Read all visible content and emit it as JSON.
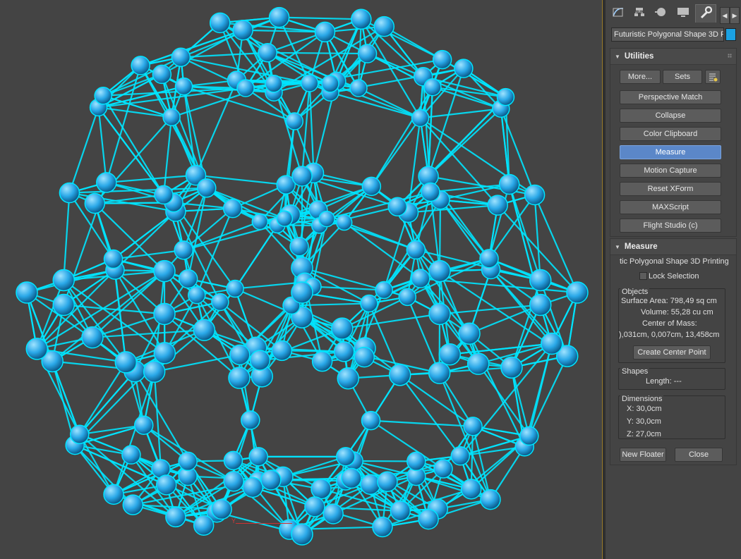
{
  "command_panel": {
    "tabs": [
      {
        "icon": "create-icon"
      },
      {
        "icon": "hierarchy-icon"
      },
      {
        "icon": "motion-icon"
      },
      {
        "icon": "display-icon"
      },
      {
        "icon": "utilities-icon",
        "active": true
      }
    ],
    "object_name": "Futuristic Polygonal Shape 3D P",
    "object_color": "#1ba1e2"
  },
  "utilities": {
    "title": "Utilities",
    "more_label": "More...",
    "sets_label": "Sets",
    "buttons": [
      {
        "label": "Perspective Match"
      },
      {
        "label": "Collapse"
      },
      {
        "label": "Color Clipboard"
      },
      {
        "label": "Measure",
        "selected": true
      },
      {
        "label": "Motion Capture"
      },
      {
        "label": "Reset XForm"
      },
      {
        "label": "MAXScript"
      },
      {
        "label": "Flight Studio (c)"
      }
    ]
  },
  "measure": {
    "title": "Measure",
    "object_name": "tic Polygonal Shape 3D Printing",
    "lock_selection_label": "Lock Selection",
    "lock_selection_checked": false,
    "objects": {
      "title": "Objects",
      "surface_area": "Surface Area: 798,49 sq cm",
      "volume": "Volume: 55,28 cu cm",
      "center_of_mass_label": "Center of Mass:",
      "center_of_mass_value": "),031cm, 0,007cm, 13,458cm",
      "create_center_point_label": "Create Center Point"
    },
    "shapes": {
      "title": "Shapes",
      "length": "Length: ---"
    },
    "dimensions": {
      "title": "Dimensions",
      "x": "X:  30,0cm",
      "y": "Y:  30,0cm",
      "z": "Z:  27,0cm"
    },
    "new_floater_label": "New Floater",
    "close_label": "Close"
  },
  "viewport": {
    "wire_color": "#00e5ff",
    "node_color": "#2aa8e8",
    "axis_label": "Y"
  }
}
